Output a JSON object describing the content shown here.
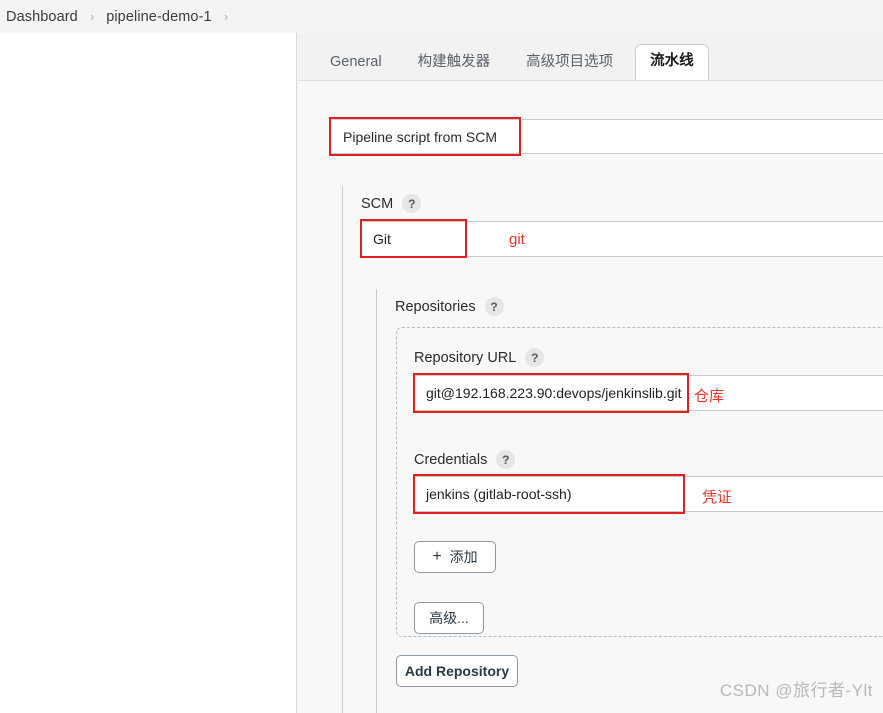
{
  "breadcrumb": {
    "items": [
      {
        "label": "Dashboard"
      },
      {
        "label": "pipeline-demo-1"
      }
    ],
    "separator": "›"
  },
  "tabs": [
    {
      "label": "General",
      "active": false
    },
    {
      "label": "构建触发器",
      "active": false
    },
    {
      "label": "高级项目选项",
      "active": false
    },
    {
      "label": "流水线",
      "active": true
    }
  ],
  "pipeline": {
    "definition": {
      "selected": "Pipeline script from SCM"
    },
    "scm": {
      "label": "SCM",
      "help": "?",
      "selected": "Git",
      "annotation": "git"
    },
    "repositories": {
      "label": "Repositories",
      "help": "?",
      "repository_url": {
        "label": "Repository URL",
        "help": "?",
        "value": "git@192.168.223.90:devops/jenkinslib.git",
        "annotation": "仓库"
      },
      "credentials": {
        "label": "Credentials",
        "help": "?",
        "value": "jenkins (gitlab-root-ssh)",
        "annotation": "凭证"
      },
      "add_button": {
        "icon": "+",
        "label": "添加"
      },
      "advanced_button": {
        "label": "高级..."
      }
    },
    "add_repository_button": {
      "label": "Add Repository"
    }
  },
  "watermark": {
    "text": "CSDN @旅行者-Ylt"
  },
  "colors": {
    "annotation_red": "#e8332a",
    "highlight_border": "#e02020",
    "page_bg": "#f8f8f8"
  }
}
